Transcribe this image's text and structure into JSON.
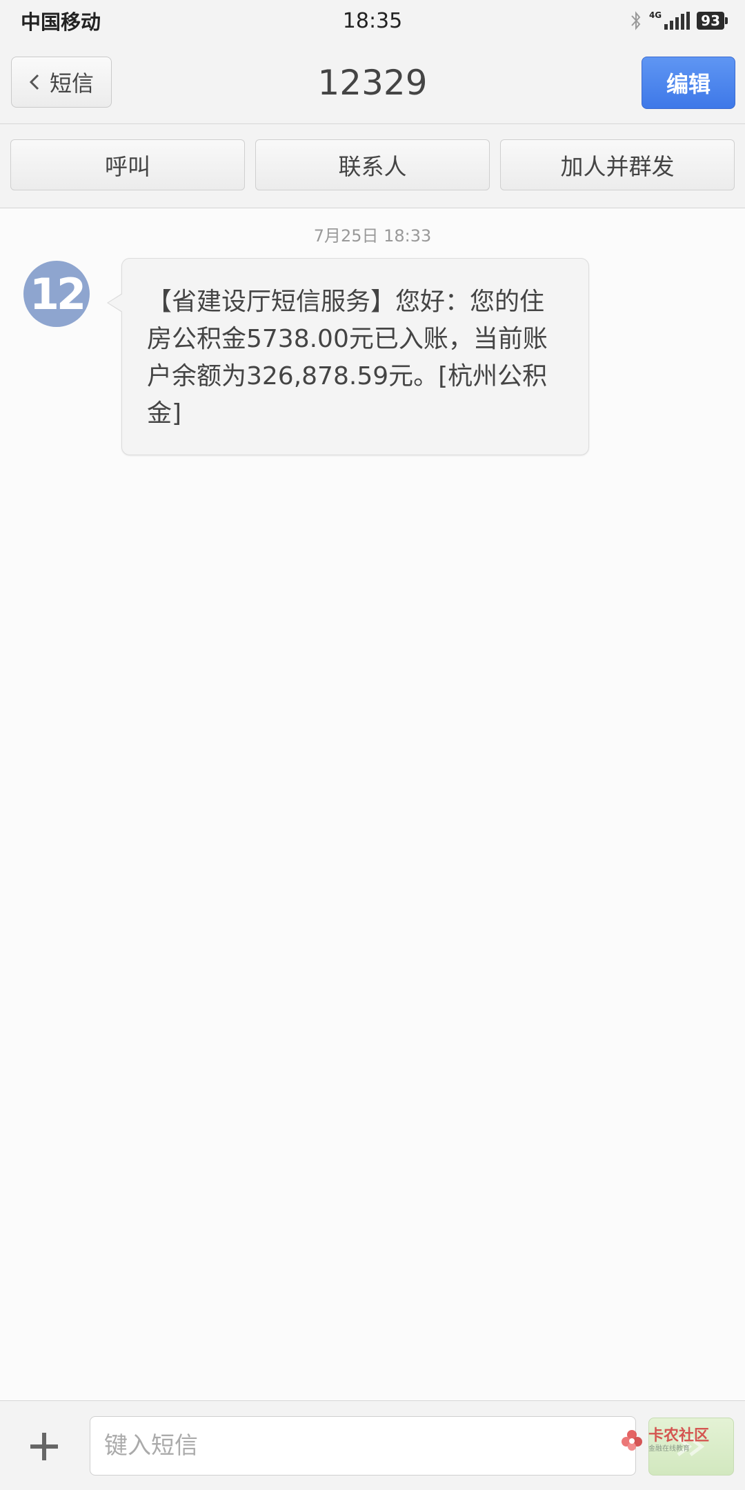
{
  "status_bar": {
    "carrier": "中国移动",
    "time": "18:35",
    "network": "4G",
    "battery": "93",
    "icons": [
      "bluetooth-icon",
      "signal-icon",
      "battery-icon"
    ]
  },
  "header": {
    "back_label": "短信",
    "title": "12329",
    "edit_label": "编辑"
  },
  "actions": {
    "call_label": "呼叫",
    "contact_label": "联系人",
    "group_send_label": "加人并群发"
  },
  "conversation": {
    "timestamp": "7月25日 18:33",
    "avatar_text": "12",
    "messages": [
      {
        "text": "【省建设厅短信服务】您好：您的住房公积金5738.00元已入账，当前账户余额为326,878.59元。[杭州公积金]"
      }
    ]
  },
  "input_bar": {
    "placeholder": "键入短信",
    "value": ""
  },
  "watermark": {
    "title": "卡农社区",
    "subtitle": "金融在线教育"
  },
  "colors": {
    "accent": "#4a84ee",
    "bar_bg": "#f3f3f3",
    "avatar_bg": "#8ea5cf",
    "send_bg": "#d8ecc6"
  }
}
